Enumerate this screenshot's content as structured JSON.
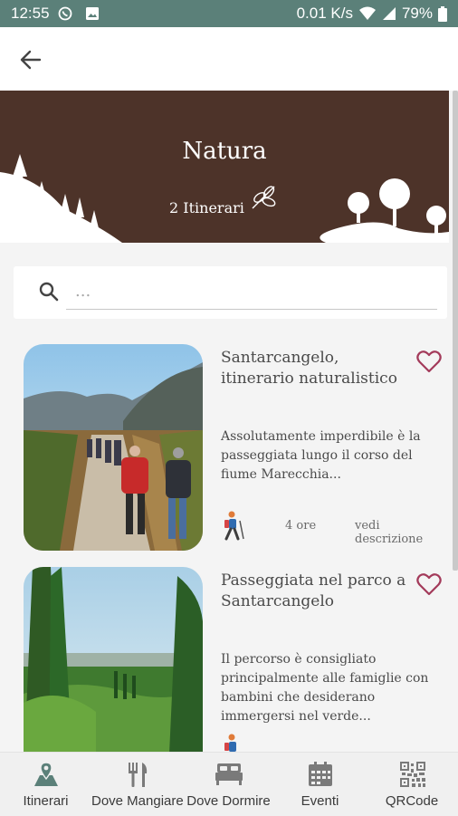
{
  "status_bar": {
    "time": "12:55",
    "network_speed": "0.01 K/s",
    "battery": "79%",
    "icons": [
      "whatsapp-icon",
      "image-icon",
      "wifi-icon",
      "signal-icon",
      "battery-icon"
    ]
  },
  "app_bar": {
    "back_icon": "arrow-left-icon"
  },
  "header": {
    "title": "Natura",
    "subtitle": "2 Itinerari",
    "icon": "leaves-icon",
    "background_color": "#4d3329"
  },
  "search": {
    "placeholder": "...",
    "value": "",
    "icon": "search-icon"
  },
  "itineraries": [
    {
      "title": "Santarcangelo, itinerario naturalistico",
      "description": "Assolutamente imperdibile è la passeggiata lungo il corso del fiume Marecchia...",
      "duration": "4 ore",
      "more": "vedi descrizione",
      "favorite_icon": "heart-outline-icon",
      "activity_icon": "hiker-icon"
    },
    {
      "title": "Passeggiata nel parco a Santarcangelo",
      "description": "Il percorso è consigliato principalmente alle famiglie con bambini che desiderano immergersi nel verde...",
      "duration": "",
      "more": "",
      "favorite_icon": "heart-outline-icon",
      "activity_icon": "hiker-icon"
    }
  ],
  "bottom_nav": {
    "items": [
      {
        "label": "Itinerari",
        "icon": "map-pin-icon",
        "active": true
      },
      {
        "label": "Dove Mangiare",
        "icon": "cutlery-icon",
        "active": false
      },
      {
        "label": "Dove Dormire",
        "icon": "bed-icon",
        "active": false
      },
      {
        "label": "Eventi",
        "icon": "calendar-icon",
        "active": false
      },
      {
        "label": "QRCode",
        "icon": "qr-code-icon",
        "active": false
      }
    ]
  },
  "colors": {
    "status_bar": "#5b8079",
    "accent": "#a33a5a",
    "active_nav_icon": "#5b8079",
    "text": "#4a4a4a"
  }
}
